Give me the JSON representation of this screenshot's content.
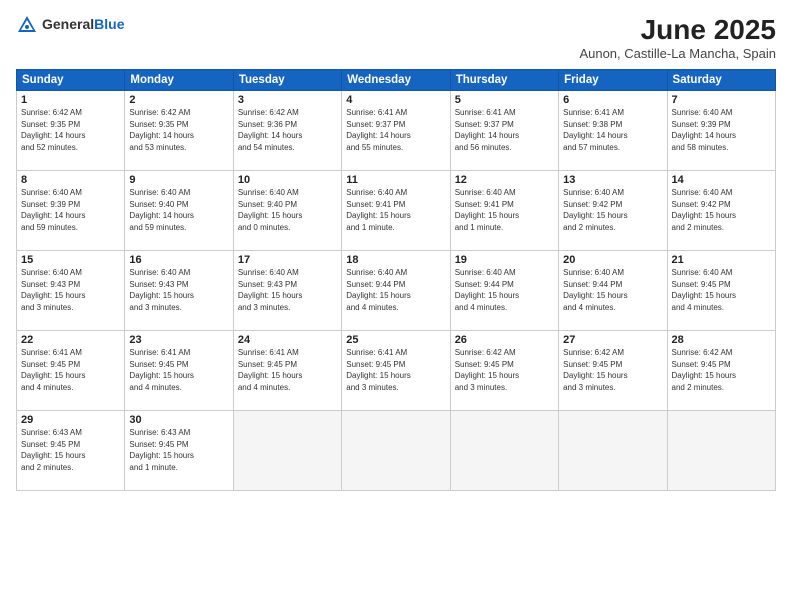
{
  "header": {
    "logo_general": "General",
    "logo_blue": "Blue",
    "title": "June 2025",
    "subtitle": "Aunon, Castille-La Mancha, Spain"
  },
  "columns": [
    "Sunday",
    "Monday",
    "Tuesday",
    "Wednesday",
    "Thursday",
    "Friday",
    "Saturday"
  ],
  "weeks": [
    [
      {
        "day": "1",
        "lines": [
          "Sunrise: 6:42 AM",
          "Sunset: 9:35 PM",
          "Daylight: 14 hours",
          "and 52 minutes."
        ]
      },
      {
        "day": "2",
        "lines": [
          "Sunrise: 6:42 AM",
          "Sunset: 9:35 PM",
          "Daylight: 14 hours",
          "and 53 minutes."
        ]
      },
      {
        "day": "3",
        "lines": [
          "Sunrise: 6:42 AM",
          "Sunset: 9:36 PM",
          "Daylight: 14 hours",
          "and 54 minutes."
        ]
      },
      {
        "day": "4",
        "lines": [
          "Sunrise: 6:41 AM",
          "Sunset: 9:37 PM",
          "Daylight: 14 hours",
          "and 55 minutes."
        ]
      },
      {
        "day": "5",
        "lines": [
          "Sunrise: 6:41 AM",
          "Sunset: 9:37 PM",
          "Daylight: 14 hours",
          "and 56 minutes."
        ]
      },
      {
        "day": "6",
        "lines": [
          "Sunrise: 6:41 AM",
          "Sunset: 9:38 PM",
          "Daylight: 14 hours",
          "and 57 minutes."
        ]
      },
      {
        "day": "7",
        "lines": [
          "Sunrise: 6:40 AM",
          "Sunset: 9:39 PM",
          "Daylight: 14 hours",
          "and 58 minutes."
        ]
      }
    ],
    [
      {
        "day": "8",
        "lines": [
          "Sunrise: 6:40 AM",
          "Sunset: 9:39 PM",
          "Daylight: 14 hours",
          "and 59 minutes."
        ]
      },
      {
        "day": "9",
        "lines": [
          "Sunrise: 6:40 AM",
          "Sunset: 9:40 PM",
          "Daylight: 14 hours",
          "and 59 minutes."
        ]
      },
      {
        "day": "10",
        "lines": [
          "Sunrise: 6:40 AM",
          "Sunset: 9:40 PM",
          "Daylight: 15 hours",
          "and 0 minutes."
        ]
      },
      {
        "day": "11",
        "lines": [
          "Sunrise: 6:40 AM",
          "Sunset: 9:41 PM",
          "Daylight: 15 hours",
          "and 1 minute."
        ]
      },
      {
        "day": "12",
        "lines": [
          "Sunrise: 6:40 AM",
          "Sunset: 9:41 PM",
          "Daylight: 15 hours",
          "and 1 minute."
        ]
      },
      {
        "day": "13",
        "lines": [
          "Sunrise: 6:40 AM",
          "Sunset: 9:42 PM",
          "Daylight: 15 hours",
          "and 2 minutes."
        ]
      },
      {
        "day": "14",
        "lines": [
          "Sunrise: 6:40 AM",
          "Sunset: 9:42 PM",
          "Daylight: 15 hours",
          "and 2 minutes."
        ]
      }
    ],
    [
      {
        "day": "15",
        "lines": [
          "Sunrise: 6:40 AM",
          "Sunset: 9:43 PM",
          "Daylight: 15 hours",
          "and 3 minutes."
        ]
      },
      {
        "day": "16",
        "lines": [
          "Sunrise: 6:40 AM",
          "Sunset: 9:43 PM",
          "Daylight: 15 hours",
          "and 3 minutes."
        ]
      },
      {
        "day": "17",
        "lines": [
          "Sunrise: 6:40 AM",
          "Sunset: 9:43 PM",
          "Daylight: 15 hours",
          "and 3 minutes."
        ]
      },
      {
        "day": "18",
        "lines": [
          "Sunrise: 6:40 AM",
          "Sunset: 9:44 PM",
          "Daylight: 15 hours",
          "and 4 minutes."
        ]
      },
      {
        "day": "19",
        "lines": [
          "Sunrise: 6:40 AM",
          "Sunset: 9:44 PM",
          "Daylight: 15 hours",
          "and 4 minutes."
        ]
      },
      {
        "day": "20",
        "lines": [
          "Sunrise: 6:40 AM",
          "Sunset: 9:44 PM",
          "Daylight: 15 hours",
          "and 4 minutes."
        ]
      },
      {
        "day": "21",
        "lines": [
          "Sunrise: 6:40 AM",
          "Sunset: 9:45 PM",
          "Daylight: 15 hours",
          "and 4 minutes."
        ]
      }
    ],
    [
      {
        "day": "22",
        "lines": [
          "Sunrise: 6:41 AM",
          "Sunset: 9:45 PM",
          "Daylight: 15 hours",
          "and 4 minutes."
        ]
      },
      {
        "day": "23",
        "lines": [
          "Sunrise: 6:41 AM",
          "Sunset: 9:45 PM",
          "Daylight: 15 hours",
          "and 4 minutes."
        ]
      },
      {
        "day": "24",
        "lines": [
          "Sunrise: 6:41 AM",
          "Sunset: 9:45 PM",
          "Daylight: 15 hours",
          "and 4 minutes."
        ]
      },
      {
        "day": "25",
        "lines": [
          "Sunrise: 6:41 AM",
          "Sunset: 9:45 PM",
          "Daylight: 15 hours",
          "and 3 minutes."
        ]
      },
      {
        "day": "26",
        "lines": [
          "Sunrise: 6:42 AM",
          "Sunset: 9:45 PM",
          "Daylight: 15 hours",
          "and 3 minutes."
        ]
      },
      {
        "day": "27",
        "lines": [
          "Sunrise: 6:42 AM",
          "Sunset: 9:45 PM",
          "Daylight: 15 hours",
          "and 3 minutes."
        ]
      },
      {
        "day": "28",
        "lines": [
          "Sunrise: 6:42 AM",
          "Sunset: 9:45 PM",
          "Daylight: 15 hours",
          "and 2 minutes."
        ]
      }
    ],
    [
      {
        "day": "29",
        "lines": [
          "Sunrise: 6:43 AM",
          "Sunset: 9:45 PM",
          "Daylight: 15 hours",
          "and 2 minutes."
        ]
      },
      {
        "day": "30",
        "lines": [
          "Sunrise: 6:43 AM",
          "Sunset: 9:45 PM",
          "Daylight: 15 hours",
          "and 1 minute."
        ]
      },
      null,
      null,
      null,
      null,
      null
    ]
  ]
}
